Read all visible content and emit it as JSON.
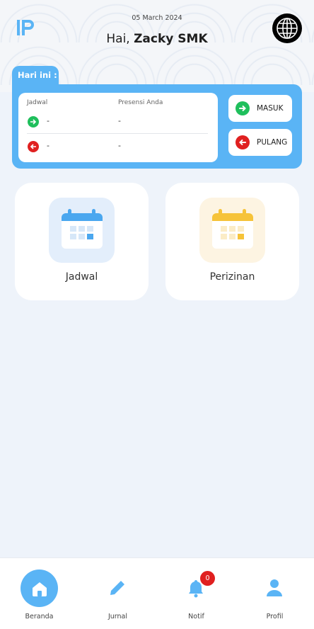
{
  "header": {
    "date": "05 March 2024",
    "greeting_prefix": "Hai, ",
    "user_name": "Zacky SMK"
  },
  "today": {
    "tab_label": "Hari ini :",
    "col_schedule": "Jadwal",
    "col_presence": "Presensi Anda",
    "in_schedule": "-",
    "in_presence": "-",
    "out_schedule": "-",
    "out_presence": "-",
    "checkin_label": "MASUK",
    "checkout_label": "PULANG"
  },
  "menu": {
    "schedule_label": "Jadwal",
    "permit_label": "Perizinan"
  },
  "nav": {
    "home": "Beranda",
    "journal": "Jurnal",
    "notif": "Notif",
    "notif_count": "0",
    "profile": "Profil"
  },
  "colors": {
    "accent": "#5ab4f5",
    "green": "#1fbf5c",
    "red": "#e02020",
    "yellow": "#f6c339"
  }
}
